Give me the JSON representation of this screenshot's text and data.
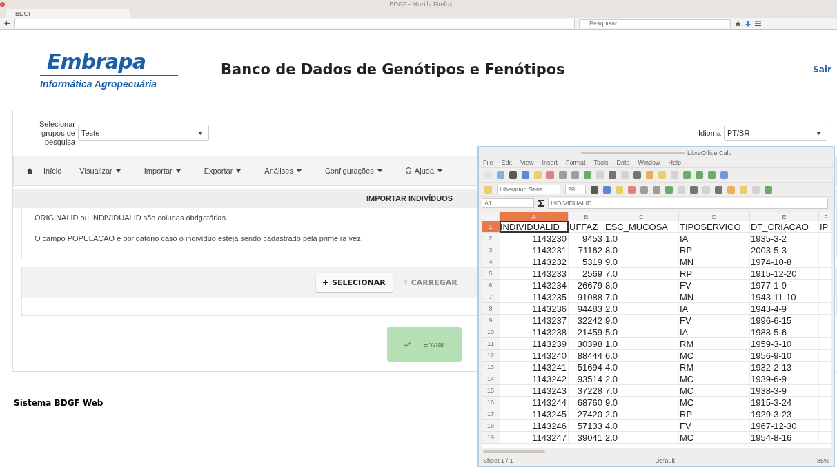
{
  "browser": {
    "title": "BDGF - Mozilla Firefox",
    "tab": "BDGF",
    "search_placeholder": "Pesquisar"
  },
  "header": {
    "logo": "Embrapa",
    "logo_subtitle": "Informática Agropecuária",
    "title": "Banco de Dados de Genótipos e Fenótipos",
    "logout": "Sair"
  },
  "filter": {
    "label": "Selecionar grupos de pesquisa",
    "value": "Teste",
    "language_label": "Idioma",
    "language": "PT/BR"
  },
  "nav": [
    {
      "label": "Início",
      "kind": "home"
    },
    {
      "label": "Visualizar",
      "kind": "menu"
    },
    {
      "label": "Importar",
      "kind": "menu"
    },
    {
      "label": "Exportar",
      "kind": "menu"
    },
    {
      "label": "Análises",
      "kind": "menu"
    },
    {
      "label": "Configurações",
      "kind": "menu"
    },
    {
      "label": "Ajuda",
      "kind": "help"
    }
  ],
  "panel": {
    "title": "IMPORTAR INDIVÍDUOS",
    "notes": [
      "ORIGINALID ou INDIVIDUALID são colunas obrigatórias.",
      "O campo POPULACAO é obrigatório caso o indivíduo esteja sendo cadastrado pela primeira vez."
    ],
    "upload_buttons": [
      {
        "label": "SELECIONAR",
        "disabled": false
      },
      {
        "label": "CARREGAR",
        "disabled": true
      }
    ],
    "submit": {
      "label": "Enviar",
      "disabled": true
    }
  },
  "footer": "Sistema BDGF Web",
  "calc": {
    "title": "LibreOffice Calc",
    "menu": [
      "File",
      "Edit",
      "View",
      "Insert",
      "Format",
      "Tools",
      "Data",
      "Window",
      "Help"
    ],
    "font": "Liberation Sans",
    "font_size": "20",
    "name_box": "A1",
    "formula": "INDIVIDUALID",
    "columns": [
      {
        "label": "A",
        "selected": true
      },
      {
        "label": "B",
        "selected": false
      },
      {
        "label": "C",
        "selected": false
      },
      {
        "label": "D",
        "selected": false
      },
      {
        "label": "E",
        "selected": false
      },
      {
        "label": "F",
        "selected": false
      }
    ],
    "rows": [
      {
        "number": "1",
        "selected": true,
        "cells": [
          "INDIVIDUALID",
          "UFFAZ",
          "ESC_MUCOSA",
          "TIPOSERVICO",
          "DT_CRIACAO",
          "IP"
        ]
      },
      {
        "number": "2",
        "selected": false,
        "cells": [
          "1143230",
          "9453",
          "1.0",
          "IA",
          "1935-3-2"
        ]
      },
      {
        "number": "3",
        "selected": false,
        "cells": [
          "1143231",
          "71162",
          "8.0",
          "RP",
          "2003-5-3"
        ]
      },
      {
        "number": "4",
        "selected": false,
        "cells": [
          "1143232",
          "5319",
          "9.0",
          "MN",
          "1974-10-8"
        ]
      },
      {
        "number": "5",
        "selected": false,
        "cells": [
          "1143233",
          "2569",
          "7.0",
          "RP",
          "1915-12-20"
        ]
      },
      {
        "number": "6",
        "selected": false,
        "cells": [
          "1143234",
          "26679",
          "8.0",
          "FV",
          "1977-1-9"
        ]
      },
      {
        "number": "7",
        "selected": false,
        "cells": [
          "1143235",
          "91088",
          "7.0",
          "MN",
          "1943-11-10"
        ]
      },
      {
        "number": "8",
        "selected": false,
        "cells": [
          "1143236",
          "94483",
          "2.0",
          "IA",
          "1943-4-9"
        ]
      },
      {
        "number": "9",
        "selected": false,
        "cells": [
          "1143237",
          "32242",
          "9.0",
          "FV",
          "1996-6-15"
        ]
      },
      {
        "number": "10",
        "selected": false,
        "cells": [
          "1143238",
          "21459",
          "5.0",
          "IA",
          "1988-5-6"
        ]
      },
      {
        "number": "11",
        "selected": false,
        "cells": [
          "1143239",
          "30398",
          "1.0",
          "RM",
          "1959-3-10"
        ]
      },
      {
        "number": "12",
        "selected": false,
        "cells": [
          "1143240",
          "88444",
          "6.0",
          "MC",
          "1956-9-10"
        ]
      },
      {
        "number": "13",
        "selected": false,
        "cells": [
          "1143241",
          "51694",
          "4.0",
          "RM",
          "1932-2-13"
        ]
      },
      {
        "number": "14",
        "selected": false,
        "cells": [
          "1143242",
          "93514",
          "2.0",
          "MC",
          "1939-6-9"
        ]
      },
      {
        "number": "15",
        "selected": false,
        "cells": [
          "1143243",
          "37228",
          "7.0",
          "MC",
          "1938-3-9"
        ]
      },
      {
        "number": "16",
        "selected": false,
        "cells": [
          "1143244",
          "68760",
          "9.0",
          "MC",
          "1915-3-24"
        ]
      },
      {
        "number": "17",
        "selected": false,
        "cells": [
          "1143245",
          "27420",
          "2.0",
          "RP",
          "1929-3-23"
        ]
      },
      {
        "number": "18",
        "selected": false,
        "cells": [
          "1143246",
          "57133",
          "4.0",
          "FV",
          "1967-12-30"
        ]
      },
      {
        "number": "19",
        "selected": false,
        "cells": [
          "1143247",
          "39041",
          "2.0",
          "MC",
          "1954-8-16"
        ]
      }
    ],
    "status": {
      "sheet": "Sheet 1 / 1",
      "style": "Default",
      "zoom": "85%"
    }
  }
}
